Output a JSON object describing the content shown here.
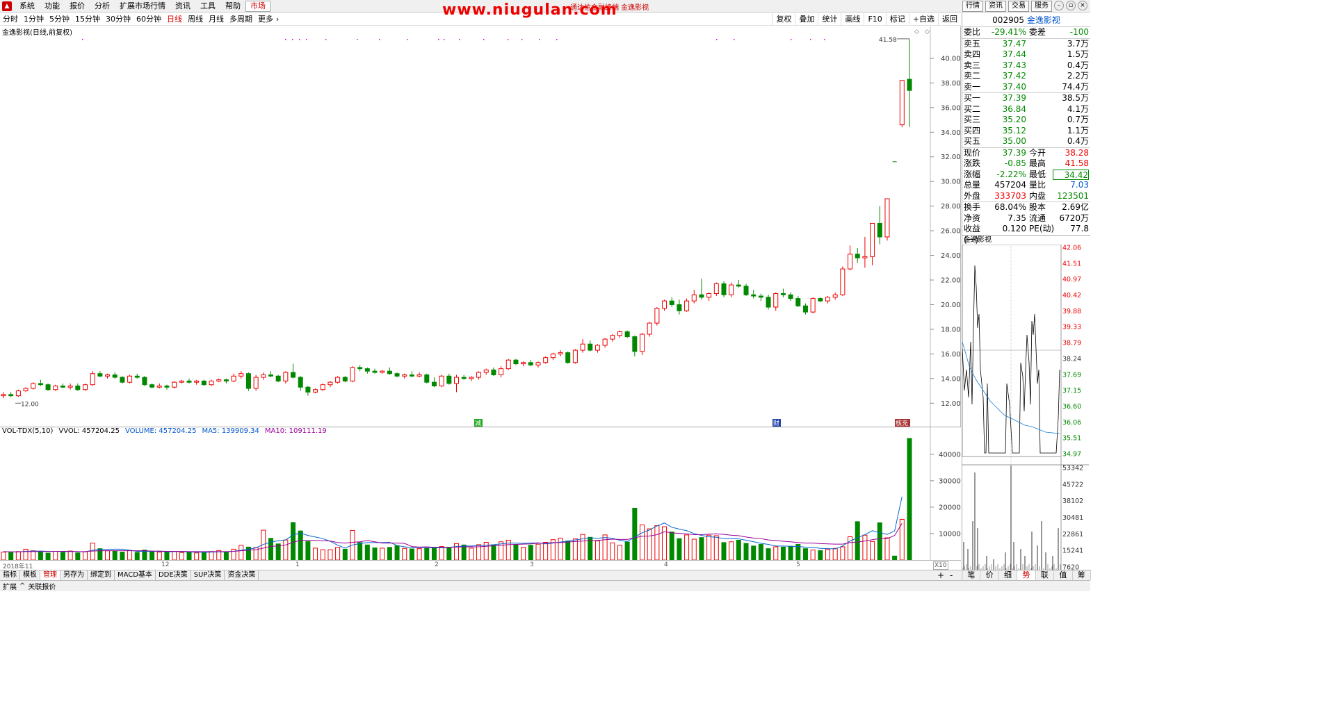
{
  "menu": {
    "items": [
      "系统",
      "功能",
      "报价",
      "分析",
      "扩展市场行情",
      "资讯",
      "工具",
      "帮助"
    ],
    "active": "市场"
  },
  "watermark": "www.niugulan.com",
  "window_subtitle": "通达信金融终端 金逸影视",
  "top_right": [
    "行情",
    "资讯",
    "交易",
    "服务"
  ],
  "periods": {
    "items": [
      "分时",
      "1分钟",
      "5分钟",
      "15分钟",
      "30分钟",
      "60分钟",
      "日线",
      "周线",
      "月线",
      "多周期",
      "更多"
    ],
    "active": "日线"
  },
  "chart_tools": [
    "复权",
    "叠加",
    "统计",
    "画线",
    "F10",
    "标记",
    "+自选",
    "返回"
  ],
  "chart_title": "金逸影视(日线,前复权)",
  "price_markers": {
    "high_label": "41.58",
    "low_label": "12.00"
  },
  "price_axis": [
    "40.00",
    "38.00",
    "36.00",
    "34.00",
    "32.00",
    "30.00",
    "28.00",
    "26.00",
    "24.00",
    "22.00",
    "20.00",
    "18.00",
    "16.00",
    "14.00",
    "12.00"
  ],
  "events": [
    "减",
    "财",
    "核充"
  ],
  "volume": {
    "name": "VOL-TDX(5,10)",
    "vvol": "VVOL: 457204.25",
    "volume": "VOLUME: 457204.25",
    "ma5": "MA5: 139909.34",
    "ma10": "MA10: 109111.19",
    "axis": [
      "40000",
      "30000",
      "20000",
      "10000"
    ],
    "unit": "X10"
  },
  "xaxis": [
    "2018年11",
    "12",
    "1",
    "2",
    "3",
    "4",
    "5"
  ],
  "bottom_tabs": [
    "指标",
    "模板",
    "管理",
    "另存为",
    "绑定到",
    "MACD基本",
    "DDE决策",
    "SUP决策",
    "资金决策"
  ],
  "bottom_active": "管理",
  "status": [
    "扩展",
    "关联报价"
  ],
  "quote": {
    "code": "002905",
    "name": "金逸影视",
    "weibi_label": "委比",
    "weibi": "-29.41%",
    "weicha_label": "委差",
    "weicha": "-100",
    "sells": [
      [
        "卖五",
        "37.47",
        "3.7万"
      ],
      [
        "卖四",
        "37.44",
        "1.5万"
      ],
      [
        "卖三",
        "37.43",
        "0.4万"
      ],
      [
        "卖二",
        "37.42",
        "2.2万"
      ],
      [
        "卖一",
        "37.40",
        "74.4万"
      ]
    ],
    "buys": [
      [
        "买一",
        "37.39",
        "38.5万"
      ],
      [
        "买二",
        "36.84",
        "4.1万"
      ],
      [
        "买三",
        "35.20",
        "0.7万"
      ],
      [
        "买四",
        "35.12",
        "1.1万"
      ],
      [
        "买五",
        "35.00",
        "0.4万"
      ]
    ],
    "stats": [
      [
        "现价",
        "37.39",
        "今开",
        "38.28"
      ],
      [
        "涨跌",
        "-0.85",
        "最高",
        "41.58"
      ],
      [
        "涨幅",
        "-2.22%",
        "最低",
        "34.42"
      ],
      [
        "总量",
        "457204",
        "量比",
        "7.03"
      ],
      [
        "外盘",
        "333703",
        "内盘",
        "123501"
      ]
    ],
    "stats2": [
      [
        "换手",
        "68.04%",
        "股本",
        "2.69亿"
      ],
      [
        "净资",
        "7.35",
        "流通",
        "6720万"
      ],
      [
        "收益(一)",
        "0.120",
        "PE(动)",
        "77.8"
      ]
    ]
  },
  "mini": {
    "title": "金逸影视",
    "price_axis": [
      "42.06",
      "41.51",
      "40.97",
      "40.42",
      "39.88",
      "39.33",
      "38.79",
      "38.24",
      "37.69",
      "37.15",
      "36.60",
      "36.06",
      "35.51",
      "34.97"
    ],
    "vol_axis": [
      "53342",
      "45722",
      "38102",
      "30481",
      "22861",
      "15241",
      "7620"
    ]
  },
  "right_tabs": [
    "笔",
    "价",
    "细",
    "势",
    "联",
    "值",
    "筹"
  ],
  "right_tab_active": "势",
  "chart_data": {
    "type": "candlestick",
    "title": "金逸影视(日线,前复权)",
    "ylim": [
      11,
      41.6
    ],
    "ohlc": [
      [
        12.6,
        12.9,
        12.4,
        12.7
      ],
      [
        12.7,
        12.9,
        12.5,
        12.6
      ],
      [
        12.6,
        13.1,
        12.5,
        13.0
      ],
      [
        13.0,
        13.3,
        12.9,
        13.2
      ],
      [
        13.2,
        13.7,
        13.1,
        13.6
      ],
      [
        13.6,
        13.9,
        13.4,
        13.5
      ],
      [
        13.5,
        13.6,
        13.0,
        13.1
      ],
      [
        13.1,
        13.5,
        13.0,
        13.4
      ],
      [
        13.4,
        13.6,
        13.2,
        13.3
      ],
      [
        13.3,
        13.6,
        13.1,
        13.4
      ],
      [
        13.4,
        13.6,
        13.0,
        13.1
      ],
      [
        13.1,
        13.6,
        13.0,
        13.5
      ],
      [
        13.5,
        14.6,
        13.4,
        14.4
      ],
      [
        14.4,
        14.6,
        14.1,
        14.2
      ],
      [
        14.2,
        14.4,
        14.0,
        14.3
      ],
      [
        14.3,
        14.5,
        14.0,
        14.1
      ],
      [
        14.1,
        14.2,
        13.6,
        13.7
      ],
      [
        13.7,
        14.3,
        13.6,
        14.2
      ],
      [
        14.2,
        14.4,
        14.0,
        14.1
      ],
      [
        14.1,
        14.2,
        13.4,
        13.5
      ],
      [
        13.5,
        13.6,
        13.2,
        13.3
      ],
      [
        13.3,
        13.6,
        13.2,
        13.4
      ],
      [
        13.4,
        13.5,
        13.1,
        13.3
      ],
      [
        13.3,
        13.8,
        13.2,
        13.7
      ],
      [
        13.7,
        13.9,
        13.6,
        13.8
      ],
      [
        13.8,
        14.0,
        13.6,
        13.7
      ],
      [
        13.7,
        13.9,
        13.5,
        13.8
      ],
      [
        13.8,
        13.9,
        13.4,
        13.5
      ],
      [
        13.5,
        13.9,
        13.4,
        13.8
      ],
      [
        13.8,
        14.0,
        13.7,
        13.9
      ],
      [
        13.9,
        14.0,
        13.6,
        13.8
      ],
      [
        13.8,
        14.4,
        13.7,
        14.2
      ],
      [
        14.2,
        14.6,
        14.0,
        14.4
      ],
      [
        14.4,
        14.5,
        13.0,
        13.2
      ],
      [
        13.2,
        14.3,
        13.0,
        14.1
      ],
      [
        14.1,
        14.5,
        13.9,
        14.3
      ],
      [
        14.3,
        14.6,
        14.1,
        14.2
      ],
      [
        14.2,
        14.3,
        13.7,
        13.8
      ],
      [
        13.8,
        14.6,
        13.6,
        14.5
      ],
      [
        14.5,
        15.2,
        14.0,
        14.1
      ],
      [
        14.1,
        14.2,
        13.0,
        13.3
      ],
      [
        13.3,
        13.4,
        12.6,
        12.9
      ],
      [
        12.9,
        13.2,
        12.8,
        13.1
      ],
      [
        13.1,
        13.6,
        13.0,
        13.5
      ],
      [
        13.5,
        13.8,
        13.3,
        13.7
      ],
      [
        13.7,
        14.2,
        13.6,
        14.1
      ],
      [
        14.1,
        14.2,
        13.7,
        13.8
      ],
      [
        13.8,
        15.0,
        13.7,
        14.9
      ],
      [
        14.9,
        15.1,
        14.6,
        14.8
      ],
      [
        14.8,
        14.9,
        14.4,
        14.6
      ],
      [
        14.6,
        14.8,
        14.4,
        14.5
      ],
      [
        14.5,
        14.7,
        14.4,
        14.6
      ],
      [
        14.6,
        14.9,
        14.3,
        14.4
      ],
      [
        14.4,
        14.5,
        14.1,
        14.2
      ],
      [
        14.2,
        14.4,
        14.0,
        14.3
      ],
      [
        14.3,
        14.6,
        14.1,
        14.2
      ],
      [
        14.2,
        14.5,
        14.1,
        14.3
      ],
      [
        14.3,
        14.4,
        13.6,
        13.7
      ],
      [
        13.7,
        14.1,
        13.3,
        13.4
      ],
      [
        13.4,
        14.3,
        13.3,
        14.2
      ],
      [
        14.2,
        14.4,
        13.5,
        13.6
      ],
      [
        13.6,
        14.3,
        12.9,
        14.1
      ],
      [
        14.1,
        14.3,
        13.9,
        14.0
      ],
      [
        14.0,
        14.2,
        13.8,
        14.1
      ],
      [
        14.1,
        14.6,
        13.9,
        14.5
      ],
      [
        14.5,
        14.8,
        14.3,
        14.7
      ],
      [
        14.7,
        14.9,
        14.2,
        14.3
      ],
      [
        14.3,
        15.0,
        14.1,
        14.8
      ],
      [
        14.8,
        15.6,
        14.7,
        15.5
      ],
      [
        15.5,
        15.6,
        15.1,
        15.2
      ],
      [
        15.2,
        15.4,
        15.0,
        15.3
      ],
      [
        15.3,
        15.5,
        15.0,
        15.1
      ],
      [
        15.1,
        15.4,
        14.9,
        15.3
      ],
      [
        15.3,
        15.8,
        15.2,
        15.7
      ],
      [
        15.7,
        16.1,
        15.5,
        16.0
      ],
      [
        16.0,
        16.3,
        15.8,
        16.1
      ],
      [
        16.1,
        16.2,
        15.2,
        15.3
      ],
      [
        15.3,
        16.4,
        15.2,
        16.3
      ],
      [
        16.3,
        17.2,
        16.1,
        16.8
      ],
      [
        16.8,
        17.1,
        16.2,
        16.3
      ],
      [
        16.3,
        16.8,
        16.1,
        16.7
      ],
      [
        16.7,
        17.3,
        16.5,
        17.2
      ],
      [
        17.2,
        17.6,
        17.0,
        17.5
      ],
      [
        17.5,
        17.9,
        17.3,
        17.8
      ],
      [
        17.8,
        17.9,
        17.3,
        17.4
      ],
      [
        17.4,
        17.5,
        15.8,
        16.2
      ],
      [
        16.2,
        17.7,
        15.9,
        17.6
      ],
      [
        17.6,
        18.6,
        17.4,
        18.5
      ],
      [
        18.5,
        19.8,
        18.3,
        19.7
      ],
      [
        19.7,
        20.4,
        19.5,
        20.3
      ],
      [
        20.3,
        20.6,
        19.8,
        20.0
      ],
      [
        20.0,
        20.4,
        19.2,
        19.5
      ],
      [
        19.5,
        20.5,
        19.4,
        20.3
      ],
      [
        20.3,
        21.2,
        20.1,
        20.8
      ],
      [
        20.8,
        22.1,
        20.4,
        20.6
      ],
      [
        20.6,
        21.0,
        20.3,
        20.9
      ],
      [
        20.9,
        21.8,
        20.7,
        21.7
      ],
      [
        21.7,
        21.9,
        20.6,
        20.8
      ],
      [
        20.8,
        21.8,
        20.6,
        21.6
      ],
      [
        21.6,
        22.0,
        21.4,
        21.5
      ],
      [
        21.5,
        21.7,
        20.7,
        20.8
      ],
      [
        20.8,
        21.2,
        20.5,
        20.7
      ],
      [
        20.7,
        20.9,
        20.3,
        20.6
      ],
      [
        20.6,
        20.8,
        19.6,
        19.8
      ],
      [
        19.8,
        21.0,
        19.5,
        20.9
      ],
      [
        20.9,
        21.3,
        20.6,
        20.8
      ],
      [
        20.8,
        21.0,
        20.3,
        20.5
      ],
      [
        20.5,
        20.7,
        19.8,
        19.9
      ],
      [
        19.9,
        20.1,
        19.2,
        19.4
      ],
      [
        19.4,
        20.6,
        19.3,
        20.5
      ],
      [
        20.5,
        20.6,
        20.2,
        20.3
      ],
      [
        20.3,
        20.7,
        20.1,
        20.6
      ],
      [
        20.6,
        21.0,
        20.4,
        20.8
      ],
      [
        20.8,
        23.1,
        20.7,
        22.9
      ],
      [
        22.9,
        24.8,
        22.8,
        24.1
      ],
      [
        24.1,
        24.6,
        23.4,
        23.8
      ],
      [
        23.8,
        25.5,
        23.0,
        23.9
      ],
      [
        23.9,
        26.6,
        23.2,
        26.6
      ],
      [
        26.6,
        28.0,
        24.9,
        25.5
      ],
      [
        25.5,
        28.6,
        25.2,
        28.6
      ],
      [
        null,
        null,
        null,
        null
      ],
      [
        34.6,
        38.2,
        34.4,
        38.2
      ],
      [
        38.3,
        41.58,
        34.42,
        37.39
      ]
    ],
    "volume": [
      3000,
      2800,
      3200,
      4100,
      3500,
      3000,
      2600,
      3300,
      2900,
      3400,
      2700,
      3100,
      6400,
      4300,
      3500,
      3300,
      3000,
      3600,
      2900,
      3800,
      3100,
      3000,
      2900,
      3200,
      2800,
      3100,
      2700,
      2900,
      3200,
      3600,
      3000,
      4100,
      5600,
      4900,
      4700,
      11300,
      8200,
      6100,
      7600,
      14200,
      11000,
      7000,
      4500,
      3900,
      3900,
      4800,
      4100,
      11200,
      6600,
      5700,
      4600,
      4500,
      4800,
      5400,
      4400,
      4200,
      4300,
      4600,
      4800,
      5100,
      4800,
      6200,
      5700,
      4500,
      5800,
      6700,
      5700,
      6900,
      7500,
      5700,
      4800,
      5600,
      6000,
      6700,
      7700,
      8300,
      7200,
      8000,
      9700,
      8600,
      7200,
      9500,
      6500,
      5600,
      6800,
      19600,
      13300,
      11800,
      13000,
      12600,
      10600,
      8100,
      9500,
      7900,
      8500,
      9400,
      9200,
      6600,
      6900,
      7500,
      6300,
      5300,
      5900,
      4300,
      5000,
      4900,
      5200,
      5900,
      4300,
      3800,
      3600,
      4000,
      4400,
      5000,
      8800,
      14500,
      9400,
      7000,
      14100,
      8400,
      1500,
      15400,
      46000
    ],
    "ma5_series": [
      3200,
      3100,
      3100,
      3300,
      3400,
      3400,
      3300,
      3300,
      3200,
      3200,
      3200,
      3100,
      3700,
      4000,
      4000,
      4100,
      4100,
      3700,
      3300,
      3300,
      3300,
      3300,
      3100,
      3200,
      3200,
      3000,
      3000,
      2900,
      3000,
      3100,
      3100,
      3300,
      3700,
      4100,
      4600,
      5900,
      6800,
      7300,
      7600,
      9500,
      10200,
      9300,
      8700,
      8100,
      7100,
      5600,
      4500,
      5700,
      6200,
      6600,
      6600,
      6600,
      6700,
      5500,
      5000,
      4700,
      4700,
      4600,
      4700,
      4600,
      4800,
      5100,
      5300,
      5300,
      5500,
      5600,
      5800,
      6100,
      6400,
      6400,
      6300,
      6400,
      6500,
      6100,
      6400,
      6800,
      7200,
      7600,
      8000,
      8400,
      8200,
      8500,
      8200,
      7500,
      7000,
      8700,
      10300,
      11400,
      12900,
      14000,
      12400,
      11700,
      11100,
      10000,
      9300,
      8800,
      8600,
      8100,
      8100,
      8000,
      7500,
      6900,
      6300,
      5900,
      5300,
      5300,
      5200,
      5100,
      4900,
      4800,
      4400,
      4300,
      4200,
      5300,
      7200,
      8400,
      9600,
      11100,
      10300,
      9700,
      11000,
      24000
    ],
    "ma10_series": [
      3200,
      3100,
      3100,
      3200,
      3200,
      3200,
      3200,
      3300,
      3300,
      3300,
      3200,
      3200,
      3400,
      3500,
      3500,
      3500,
      3500,
      3500,
      3500,
      3500,
      3400,
      3400,
      3300,
      3300,
      3300,
      3200,
      3200,
      3200,
      3200,
      3200,
      3200,
      3300,
      3500,
      3700,
      3900,
      4500,
      5200,
      5300,
      5700,
      6700,
      7500,
      7500,
      7400,
      7300,
      7200,
      6600,
      6400,
      6700,
      6900,
      7400,
      6900,
      6400,
      6400,
      6400,
      6300,
      5100,
      4900,
      5000,
      4800,
      4900,
      4800,
      4900,
      5000,
      5000,
      5000,
      5200,
      5400,
      5600,
      5800,
      5900,
      6000,
      6100,
      6400,
      6400,
      6600,
      6600,
      6800,
      7000,
      7200,
      7400,
      7400,
      7700,
      7900,
      7800,
      7800,
      8400,
      9000,
      9100,
      9600,
      10700,
      10300,
      10100,
      9900,
      9600,
      9600,
      9800,
      9900,
      9700,
      9400,
      9200,
      8700,
      8300,
      8100,
      7600,
      7400,
      7100,
      6900,
      6600,
      6400,
      6400,
      6200,
      6100,
      6000,
      6000,
      6600,
      6800,
      7200,
      7700,
      8100,
      8100,
      9300,
      13900
    ]
  }
}
